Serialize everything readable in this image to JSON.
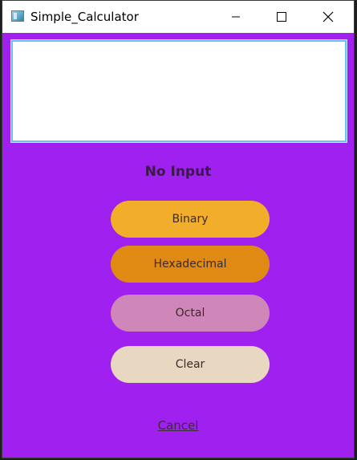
{
  "window": {
    "title": "Simple_Calculator"
  },
  "display": {
    "value": ""
  },
  "status": {
    "text": "No Input"
  },
  "buttons": {
    "binary": "Binary",
    "hexadecimal": "Hexadecimal",
    "octal": "Octal",
    "clear": "Clear",
    "cancel": "Cancel"
  },
  "icons": {
    "app": "app-icon",
    "minimize": "minimize-icon",
    "maximize": "maximize-icon",
    "close": "close-icon"
  },
  "colors": {
    "background": "#a020f0",
    "binary": "#f2ae2a",
    "hexadecimal": "#e08a14",
    "octal": "#cf86b8",
    "clear": "#e8d8c2",
    "display_border": "#67c3f3"
  }
}
